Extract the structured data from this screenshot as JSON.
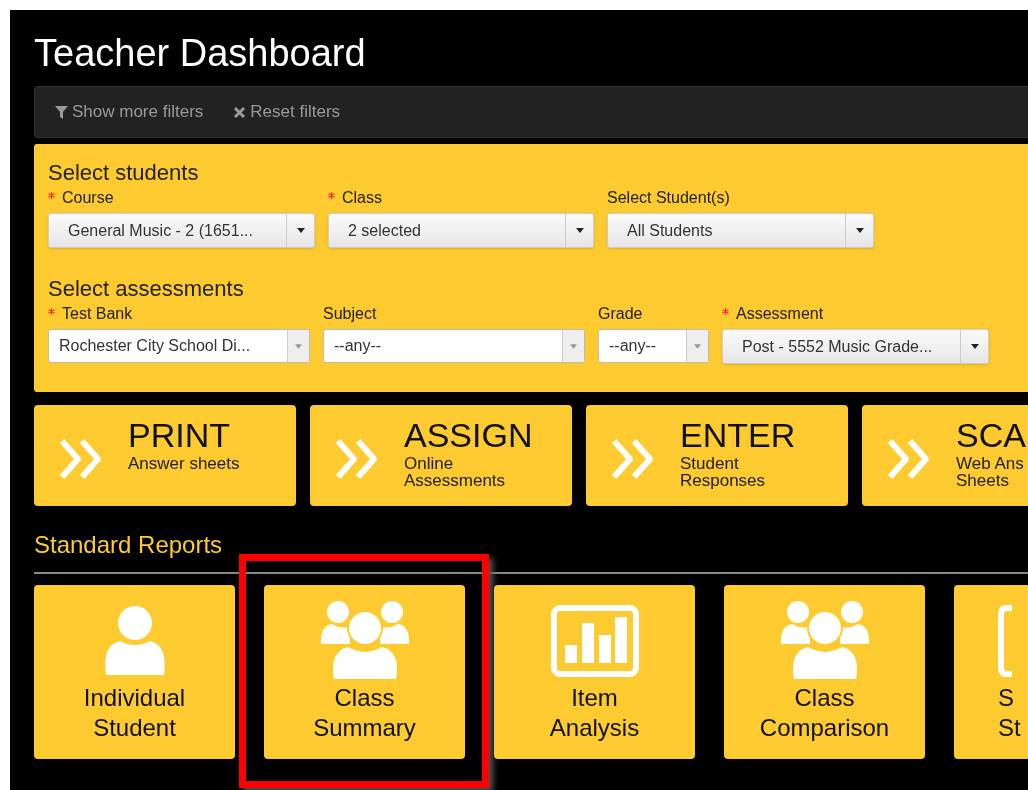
{
  "page": {
    "title": "Teacher Dashboard"
  },
  "filter_bar": [
    {
      "kind": "filter",
      "label": "Show more filters"
    },
    {
      "kind": "reset",
      "label": "Reset filters"
    }
  ],
  "selection_panel": {
    "sections": [
      {
        "heading": "Select students",
        "fields": [
          {
            "label": "Course",
            "required": true,
            "kind": "button",
            "value": "General Music - 2 (1651..."
          },
          {
            "label": "Class",
            "required": true,
            "kind": "button",
            "value": "2 selected"
          },
          {
            "label": "Select Student(s)",
            "required": false,
            "kind": "button",
            "value": "All Students"
          }
        ]
      },
      {
        "heading": "Select assessments",
        "fields": [
          {
            "label": "Test Bank",
            "required": true,
            "kind": "select",
            "value": "Rochester City School Di..."
          },
          {
            "label": "Subject",
            "required": false,
            "kind": "select",
            "value": "--any--"
          },
          {
            "label": "Grade",
            "required": false,
            "kind": "select",
            "value": "--any--"
          },
          {
            "label": "Assessment",
            "required": true,
            "kind": "button",
            "value": "Post - 5552 Music Grade..."
          }
        ]
      }
    ]
  },
  "actions": [
    {
      "title": "PRINT",
      "subtitle": [
        "Answer sheets"
      ]
    },
    {
      "title": "ASSIGN",
      "subtitle": [
        "Online",
        "Assessments"
      ]
    },
    {
      "title": "ENTER",
      "subtitle": [
        "Student",
        "Responses"
      ]
    },
    {
      "title": "SCA",
      "subtitle": [
        "Web Ans",
        "Sheets"
      ]
    }
  ],
  "standard_reports": {
    "heading": "Standard Reports",
    "tiles": [
      {
        "kind": "person",
        "lines": [
          "Individual",
          "Student"
        ],
        "highlighted": false
      },
      {
        "kind": "group",
        "lines": [
          "Class",
          "Summary"
        ],
        "highlighted": true
      },
      {
        "kind": "chart",
        "lines": [
          "Item",
          "Analysis"
        ],
        "highlighted": false
      },
      {
        "kind": "group",
        "lines": [
          "Class",
          "Comparison"
        ],
        "highlighted": false
      },
      {
        "kind": "frame",
        "lines": [
          "S",
          "St"
        ],
        "highlighted": false
      }
    ]
  }
}
